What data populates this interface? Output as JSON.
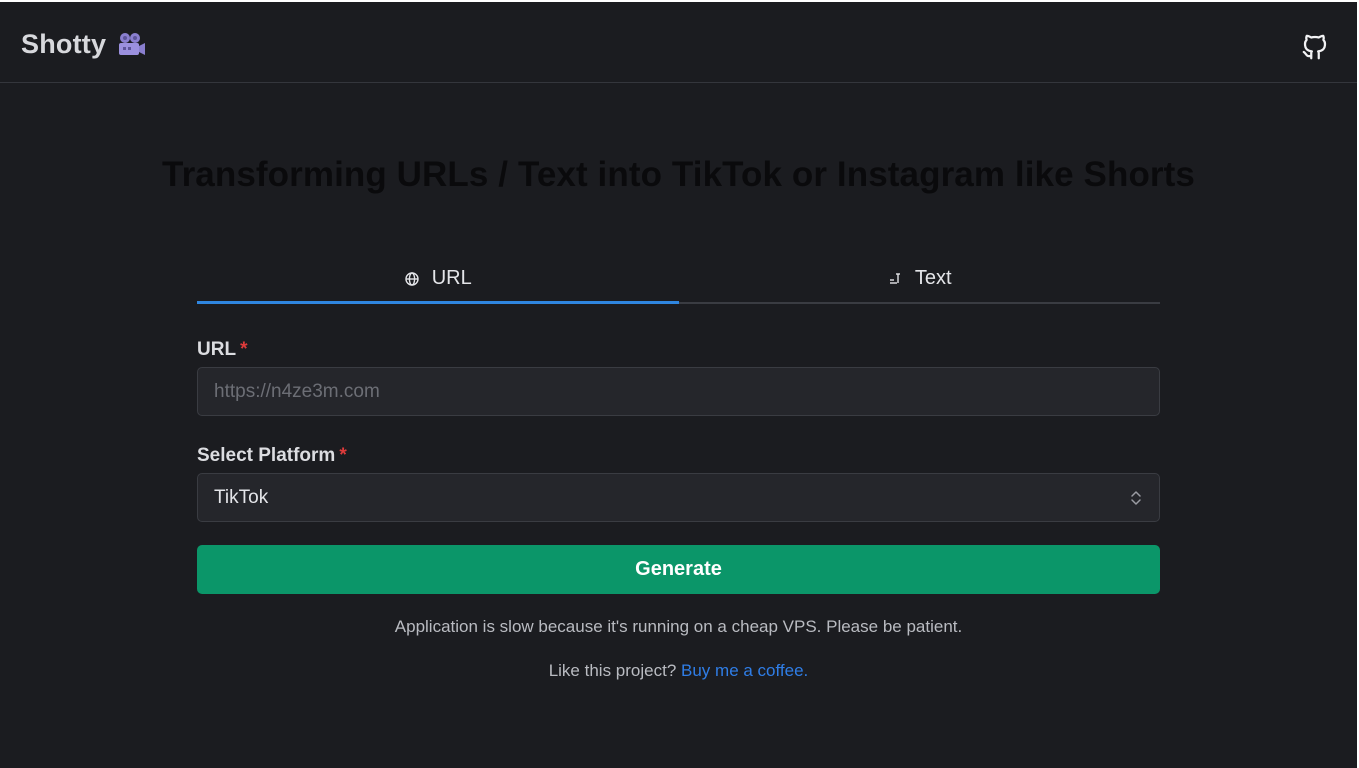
{
  "header": {
    "brand": "Shotty",
    "brand_icon": "movie-camera-icon",
    "github_icon": "github-icon"
  },
  "headline": "Transforming URLs / Text into TikTok or Instagram like Shorts",
  "tabs": [
    {
      "label": "URL",
      "icon": "globe-icon",
      "active": true
    },
    {
      "label": "Text",
      "icon": "text-icon",
      "active": false
    }
  ],
  "form": {
    "url_label": "URL",
    "url_placeholder": "https://n4ze3m.com",
    "url_value": "",
    "platform_label": "Select Platform",
    "platform_value": "TikTok",
    "required_mark": "*",
    "generate_label": "Generate"
  },
  "footer": {
    "note": "Application is slow because it's running on a cheap VPS. Please be patient.",
    "like_text": "Like this project?",
    "coffee_link": "Buy me a coffee."
  },
  "colors": {
    "background": "#1b1c20",
    "accent_tab": "#2f86e0",
    "button": "#0b9669",
    "link": "#2f7de6",
    "required": "#e03b3b"
  }
}
